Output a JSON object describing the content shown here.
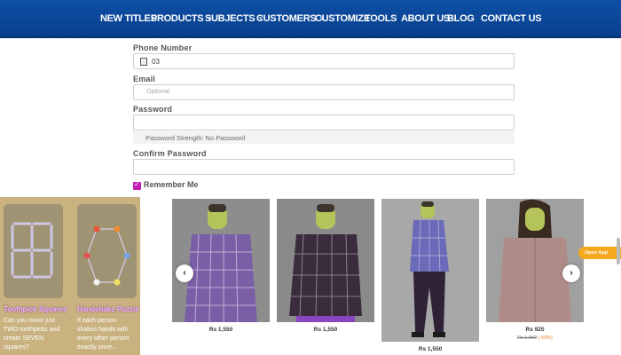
{
  "nav": {
    "items": [
      {
        "label": "NEW TITLES",
        "dropdown": false
      },
      {
        "label": "PRODUCTS",
        "dropdown": true
      },
      {
        "label": "SUBJECTS",
        "dropdown": true
      },
      {
        "label": "CUSTOMERS",
        "dropdown": true
      },
      {
        "label": "CUSTOMIZE",
        "dropdown": false
      },
      {
        "label": "TOOLS",
        "dropdown": false
      },
      {
        "label": "ABOUT US",
        "dropdown": false
      },
      {
        "label": "BLOG",
        "dropdown": false
      },
      {
        "label": "CONTACT US",
        "dropdown": false
      }
    ],
    "caret_glyph": "▼"
  },
  "form": {
    "phone_label": "Phone Number",
    "phone_value": "03",
    "email_label": "Email",
    "email_placeholder": "Optional",
    "password_label": "Password",
    "password_strength": "Password Strength: No Password",
    "confirm_label": "Confirm Password",
    "remember_label": "Remember Me",
    "remember_checked": true
  },
  "puzzles": [
    {
      "title": "Toothpick Squares",
      "description": "Can you move just TWO toothpicks and create SEVEN squares?"
    },
    {
      "title": "Handshake Puzzle",
      "description": "If each person shakes hands with every other person exactly once..."
    }
  ],
  "products": [
    {
      "price": "Rs 1,550"
    },
    {
      "price": "Rs 1,550"
    },
    {
      "price": "Rs 1,550"
    },
    {
      "price": "Rs 925",
      "old_price": "Rs 1,850",
      "discount": "(-50%)"
    }
  ],
  "carousel": {
    "prev_icon": "‹",
    "next_icon": "›"
  },
  "open_app_label": "Open App",
  "colors": {
    "nav_bg": "#0b4a9e",
    "checkbox": "#c21cb4",
    "puzzle_bg": "#c9b27f",
    "open_app": "#f4a91c"
  }
}
